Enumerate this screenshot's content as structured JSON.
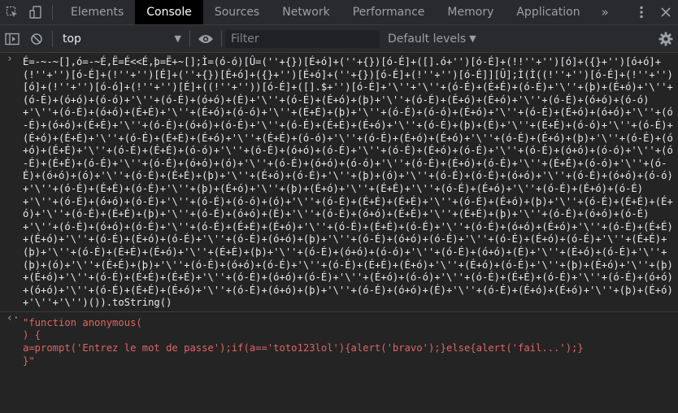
{
  "tabs": [
    "Elements",
    "Console",
    "Sources",
    "Network",
    "Performance",
    "Memory",
    "Application"
  ],
  "active_tab": "Console",
  "overflow_label": "»",
  "context": "top",
  "filter_placeholder": "Filter",
  "levels_label": "Default levels",
  "input_code": "É=-~-~[],ó=-~É,Ë=É<<É,þ=Ë+~[];Ì=(ó-ó)[Û=(''+{})[É+ó]+(''+{})[ó-É]+([].ó+'')[ó-É]+(!!''+'')[ó]+({}+'')[ó+ó]+(!''+'')[ó-É]+(!''+'')[É]+(''+{})[É+ó]+({}+'')[É+ó]+(''+{})[ó-É]+(!''+'')[ó-É]][Û];Ì(Ì((!''+'')[ó-É]+(!''+'')[ó]+(!''+'')[ó-ó]+(!''+'')[É]+((!''+''))[ó-É]+([].$+'')[ó-É]+'\\''+'\\''+(ó-É)+(É+É)+(ó-É)+'\\''+(þ)+(É+ó)+'\\''+(ó-É)+(ó+ó)+(ó-ó)+'\\''+(ó-É)+(ó+ó)+(É)+'\\''+(ó-É)+(É+ó)+(þ)+'\\''+(ó-É)+(É+ó)+(É+ó)+'\\''+(ó-É)+(ó+ó)+(ó-ó)+'\\''+(ó-É)+(ó+ó)+(É+É)+'\\''+(É+ó)+(ó-ó)+'\\''+(É+É)+(þ)+'\\''+(ó-É)+(ó-ó)+(É+ó)+'\\''+(ó-É)+(É+ó)+(ó+ó)+'\\''+(ó-É)+(ó+ó)+(É+É)+'\\''+(ó-É)+(ó+ó)+(ó-É)+'\\''+(ó-É)+(É+É)+(É+ó)+'\\''+(ó-É)+(þ)+(É)+'\\''+(É+É)+(ó-ó)+'\\''+(ó-É)+(É+ó)+(É+É)+'\\''+(ó-É)+(É+É)+(É+ó)+'\\''+(É+É)+(ó-ó)+'\\''+(ó-É)+(É+ó)+(É+ó)+'\\''+(ó-É)+(É+ó)+(þ)+'\\''+(ó-É)+(ó+ó)+(É+É)+'\\''+(ó-É)+(É+É)+(ó-ó)+'\\''+(ó-É)+(ó+ó)+(ó-É)+'\\''+(ó-É)+(É+ó)+(ó-É)+'\\''+(ó-É)+(ó+ó)+(ó-ó)+'\\''+(ó-É)+(É+É)+(ó-É)+'\\''+(ó-É)+(ó+ó)+(ó)+'\\''+(ó-É)+(ó+ó)+(ó-ó)+'\\''+(ó-É)+(É+ó)+(ó-É)+'\\''+(É+É)+(ó-ó)+'\\''+(ó-É)+(ó+ó)+(ó)+'\\''+(ó-É)+(É+É)+(þ)+'\\''+(É+ó)+(ó-É)+'\\''+(þ)+(ó)+'\\''+(ó-É)+(ó-É)+(ó+ó)+'\\''+(ó-É)+(ó+ó)+(ó-ó)+'\\''+(ó-É)+(É+É)+(ó-É)+'\\''+(þ)+(É+ó)+'\\''+(þ)+(É+ó)+'\\''+(É+É)+'\\''+(ó-É)+(É+ó)+'\\''+(ó-É)+(É+ó)+(ó-É)+'\\''+(ó-É)+(ó+ó)+(ó-É)+'\\''+(ó-É)+(ó-ó)+(ó)+'\\''+(ó-É)+(É+É)+(É+É)+'\\''+(ó-É)+(É+ó)+(þ)+'\\''+(ó-É)+(É+É)+(É+ó)+'\\''+(ó-É)+(É+É)+(þ)+'\\''+(ó-É)+(ó+ó)+(É)+'\\''+(ó-É)+(ó+ó)+(É+É)+'\\''+(É+É)+(þ)+'\\''+(ó-É)+(ó+ó)+(ó-É)+'\\''+(ó-É)+(ó+ó)+(ó-É)+'\\''+(ó-É)+(É+É)+(É+ó)+'\\''+(ó-É)+(É+É)+(ó-É)+'\\''+(ó-É)+(ó+ó)+(É+ó)+'\\''+(ó-É)+(É+É)+(É+ó)+'\\''+(ó-É)+(É+ó)+(ó-É)+'\\''+(ó-É)+(ó+ó)+(þ)+'\\''+(ó-É)+(ó+ó)+(ó-É)+'\\''+(ó-É)+(É+ó)+(ó-É)+'\\''+(É+É)+(þ)+'\\''+(ó-É)+(É+É)+(É+ó)+'\\''+(É+É)+(þ)+'\\''+(ó-É)+(ó+ó)+(ó-ó)+'\\''+(ó-É)+(ó+ó)+(É)+'\\''+(É+ó)+(ó-É)+'\\''+(þ)+(ó)+'\\''+(É+É)+(þ)+'\\''+(ó-É)+(ó+ó)+(ó-É)+'\\''+(ó-É)+(É+É)+(É+ó)+'\\''+(É+ó)+(ó-É)+'\\''+(þ)+(É+ó)+'\\''+(þ)+(É+ó)+'\\''+(ó-É)+(É+É)+(É+É)+'\\''+(ó-É)+(ó+ó)+(ó-É)+'\\''+(É+ó)+(ó-ó)+'\\''+(ó-É)+(É+É)+(ó-É)+'\\''+(ó-É)+(ó+ó)+(ó+ó)+'\\''+(ó-É)+(É+É)+(É+ó)+'\\''+(ó-É)+(ó+ó)+(þ)+'\\''+(ó-É)+(ó+ó)+(É)+'\\''+(ó-É)+(É+ó)+(É+ó)+'\\''+(þ)+(É+ó)+'\\''+'\\'')()).toString()",
  "output": {
    "line1": "\"function anonymous(",
    "line2": ") {",
    "line3": "a=prompt('Entrez le mot de passe');if(a=='toto123lol'){alert('bravo');}else{alert('fail...');}",
    "line4": "}\""
  },
  "colors": {
    "panel_bg": "#242424",
    "toolbar_bg": "#292a2d",
    "active_tab_bg": "#000000",
    "result_red": "#e16464"
  }
}
